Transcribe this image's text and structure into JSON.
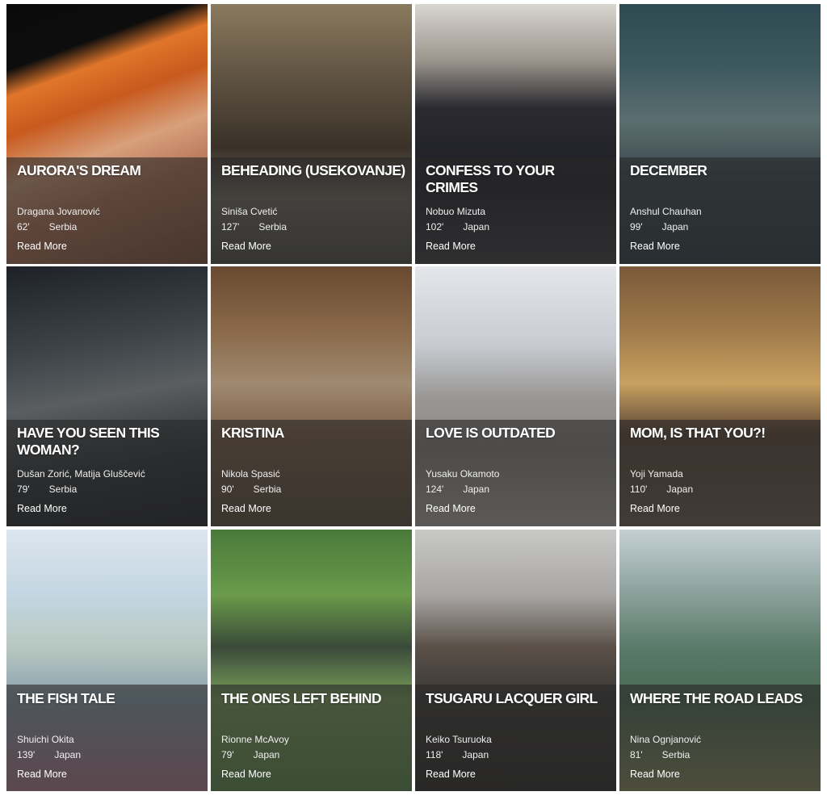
{
  "films": [
    {
      "title": "AURORA'S DREAM",
      "director": "Dragana Jovanović",
      "duration": "62'",
      "country": "Serbia",
      "read_more": "Read More",
      "bg": "linear-gradient(160deg,#0a0a0a 0%,#0d0d0d 20%,#e0762a 28%,#c85a1e 40%,#d8a07c 55%,#b57458 70%,#7a4a34 100%)"
    },
    {
      "title": "BEHEADING (USEKOVANJE)",
      "director": "Siniša Cvetić",
      "duration": "127'",
      "country": "Serbia",
      "read_more": "Read More",
      "bg": "linear-gradient(180deg,#8a7a5e 0%,#5c5040 30%,#3a3228 55%,#6e6a5e 75%,#4c4a44 100%)"
    },
    {
      "title": "CONFESS TO YOUR CRIMES",
      "director": "Nobuo Mizuta",
      "duration": "102'",
      "country": "Japan",
      "read_more": "Read More",
      "bg": "linear-gradient(180deg,#d9d6d0 0%,#9a948c 22%,#2a2a30 40%,#1e1f26 70%,#3a3a3e 100%)"
    },
    {
      "title": "DECEMBER",
      "director": "Anshul Chauhan",
      "duration": "99'",
      "country": "Japan",
      "read_more": "Read More",
      "bg": "linear-gradient(180deg,#2f4a52 0%,#3e5a60 25%,#5c6e70 45%,#3c4a4e 65%,#2a3a40 100%)"
    },
    {
      "title": "HAVE YOU SEEN THIS WOMAN?",
      "director": "Dušan Zorić, Matija Gluščević",
      "duration": "79'",
      "country": "Serbia",
      "read_more": "Read More",
      "bg": "linear-gradient(170deg,#1e2228 0%,#3c4248 30%,#5a5e60 50%,#2e3236 75%,#1a1c20 100%)"
    },
    {
      "title": "KRISTINA",
      "director": "Nikola Spasić",
      "duration": "90'",
      "country": "Serbia",
      "read_more": "Read More",
      "bg": "linear-gradient(180deg,#6a4a30 0%,#8a6a4a 25%,#a08a70 45%,#7a6048 65%,#5a4a3a 100%)"
    },
    {
      "title": "LOVE IS OUTDATED",
      "director": "Yusaku Okamoto",
      "duration": "124'",
      "country": "Japan",
      "read_more": "Read More",
      "bg": "linear-gradient(180deg,#e4e6ea 0%,#c8ccd2 30%,#9a9896 50%,#8a8580 70%,#b0aaa4 100%)"
    },
    {
      "title": "MOM, IS THAT YOU?!",
      "director": "Yoji Yamada",
      "duration": "110'",
      "country": "Japan",
      "read_more": "Read More",
      "bg": "linear-gradient(180deg,#7a5a3a 0%,#a07a4a 25%,#c8a060 45%,#5a4434 65%,#6a5a4c 100%)"
    },
    {
      "title": "THE FISH TALE",
      "director": "Shuichi Okita",
      "duration": "139'",
      "country": "Japan",
      "read_more": "Read More",
      "bg": "linear-gradient(180deg,#dce6ee 0%,#c4d6e2 25%,#b8c8c0 45%,#8aa0b0 65%,#b07a8a 100%)"
    },
    {
      "title": "THE ONES LEFT BEHIND",
      "director": "Rionne McAvoy",
      "duration": "79'",
      "country": "Japan",
      "read_more": "Read More",
      "bg": "linear-gradient(180deg,#4a7a3a 0%,#6a9a4a 25%,#3a4a3a 45%,#7aa05a 65%,#5a8a4a 100%)"
    },
    {
      "title": "TSUGARU LACQUER GIRL",
      "director": "Keiko Tsuruoka",
      "duration": "118'",
      "country": "Japan",
      "read_more": "Read More",
      "bg": "linear-gradient(180deg,#c8c8c6 0%,#a8a6a4 25%,#5a5048 45%,#3a3836 65%,#2a2826 100%)"
    },
    {
      "title": "WHERE THE ROAD LEADS",
      "director": "Nina Ognjanović",
      "duration": "81'",
      "country": "Serbia",
      "read_more": "Read More",
      "bg": "linear-gradient(180deg,#c4d0d4 0%,#8aa09a 25%,#5a7a6a 45%,#4a6a54 65%,#8a8a5a 100%)"
    }
  ]
}
